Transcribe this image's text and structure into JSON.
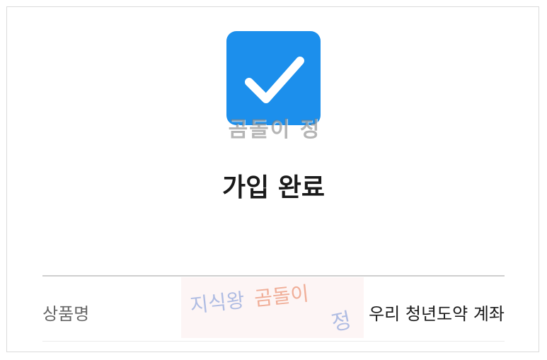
{
  "colors": {
    "accent": "#1c8fec"
  },
  "header": {
    "icon": "check-icon",
    "watermark": "곰돌이 정"
  },
  "main": {
    "title": "가입 완료"
  },
  "details": {
    "rows": [
      {
        "label": "상품명",
        "value": "우리 청년도약 계좌"
      }
    ]
  },
  "stamp": {
    "text_a": "지식왕",
    "text_b": "곰돌이",
    "text_c": "정"
  }
}
